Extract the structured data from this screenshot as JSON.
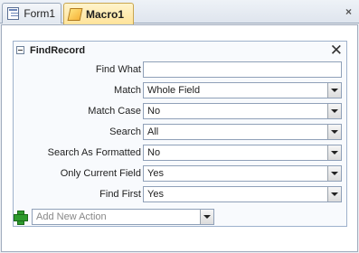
{
  "tabs": [
    {
      "label": "Form1",
      "icon": "form-icon",
      "active": false
    },
    {
      "label": "Macro1",
      "icon": "macro-icon",
      "active": true
    }
  ],
  "window": {
    "close_symbol": "×"
  },
  "action": {
    "title": "FindRecord",
    "close_symbol": "✕",
    "arguments": [
      {
        "label": "Find What",
        "value": "",
        "dropdown": false
      },
      {
        "label": "Match",
        "value": "Whole Field",
        "dropdown": true
      },
      {
        "label": "Match Case",
        "value": "No",
        "dropdown": true
      },
      {
        "label": "Search",
        "value": "All",
        "dropdown": true
      },
      {
        "label": "Search As Formatted",
        "value": "No",
        "dropdown": true
      },
      {
        "label": "Only Current Field",
        "value": "Yes",
        "dropdown": true
      },
      {
        "label": "Find First",
        "value": "Yes",
        "dropdown": true
      }
    ]
  },
  "add_action": {
    "placeholder": "Add New Action"
  }
}
